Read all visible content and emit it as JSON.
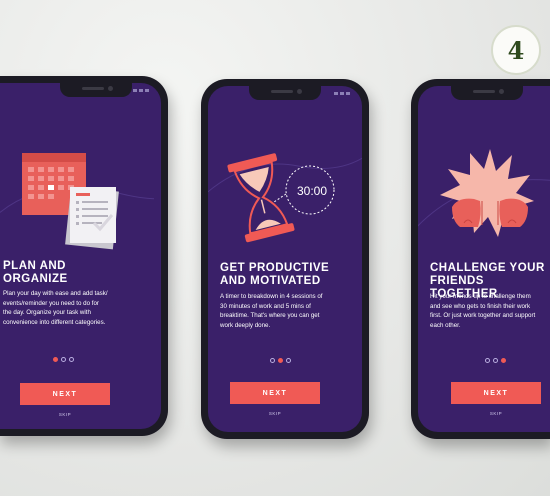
{
  "badge": {
    "number": "4"
  },
  "colors": {
    "background": "#ebecea",
    "screen": "#3a2069",
    "accent": "#f05a55",
    "phone": "#1c1b24"
  },
  "screens": [
    {
      "heading": "PLAN AND\nORGANIZE",
      "body": "Plan your day with ease and add task/\nevents/reminder you need to do for\nthe day. Organize your task with\nconvenience into different categories.",
      "active_dot": 0,
      "illustration": "calendar-todo-icon",
      "next_label": "NEXT",
      "skip_label": "SKIP"
    },
    {
      "heading": "GET PRODUCTIVE\nAND MOTIVATED",
      "body": "A timer to breakdown in 4 sessions of\n30 minutes of work and 5 mins of\nbreaktime. That's where you can get\nwork deeply done.",
      "timer": "30:00",
      "active_dot": 1,
      "illustration": "hourglass-icon",
      "next_label": "NEXT",
      "skip_label": "SKIP"
    },
    {
      "heading": "CHALLENGE YOUR\nFRIENDS TOGETHER",
      "body": "Hit your friends up to challenge them\nand see who gets to finish their work\nfirst. Or just work together and support\neach other.",
      "active_dot": 2,
      "illustration": "fist-bump-icon",
      "next_label": "NEXT",
      "skip_label": "SKIP"
    }
  ]
}
